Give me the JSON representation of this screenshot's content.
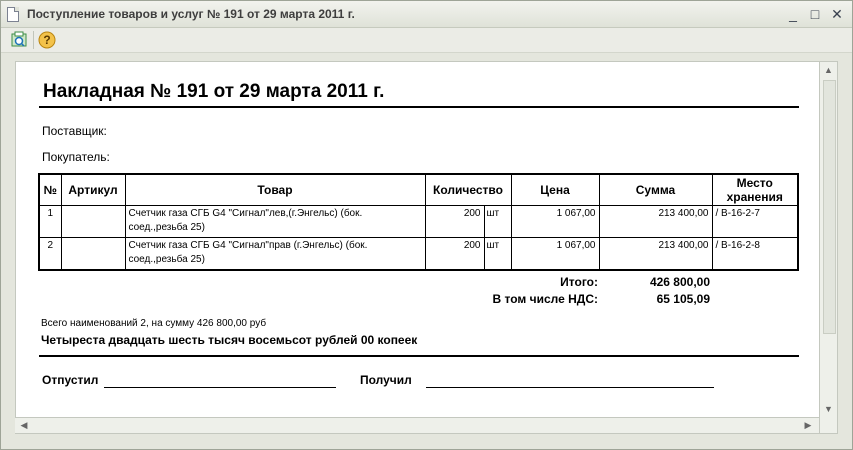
{
  "window": {
    "title": "Поступление товаров и услуг № 191 от 29 марта 2011 г.",
    "minimize": "_",
    "restore": "□",
    "close": "✕"
  },
  "document": {
    "heading": "Накладная № 191 от 29 марта 2011 г.",
    "supplier_label": "Поставщик:",
    "buyer_label": "Покупатель:",
    "table": {
      "headers": [
        "№",
        "Артикул",
        "Товар",
        "Количество",
        "Цена",
        "Сумма",
        "Место хранения"
      ],
      "rows": [
        {
          "n": "1",
          "article": "",
          "product": "Счетчик газа СГБ G4  \"Сигнал\"лев,(г.Энгельс) (бок. соед.,резьба 25)",
          "qty": "200",
          "unit": "шт",
          "price": "1 067,00",
          "sum": "213 400,00",
          "place": "/ В-16-2-7"
        },
        {
          "n": "2",
          "article": "",
          "product": "Счетчик газа СГБ G4  \"Сигнал\"прав (г.Энгельс) (бок. соед.,резьба 25)",
          "qty": "200",
          "unit": "шт",
          "price": "1 067,00",
          "sum": "213 400,00",
          "place": "/ В-16-2-8"
        }
      ]
    },
    "total_label": "Итого:",
    "total_value": "426 800,00",
    "vat_label": "В том числе НДС:",
    "vat_value": "65 105,09",
    "summary_small": "Всего наименований 2, на сумму 426 800,00 руб",
    "summary_words": "Четыреста двадцать шесть тысяч восемьсот рублей 00 копеек",
    "released_label": "Отпустил",
    "received_label": "Получил"
  },
  "colors": {
    "window_bg": "#e4e6dd",
    "page_bg": "#ffffff",
    "text": "#000000"
  },
  "icons": [
    "document-icon",
    "print-preview-icon",
    "help-icon",
    "scroll-up-icon",
    "scroll-down-icon",
    "scroll-left-icon",
    "scroll-right-icon"
  ]
}
